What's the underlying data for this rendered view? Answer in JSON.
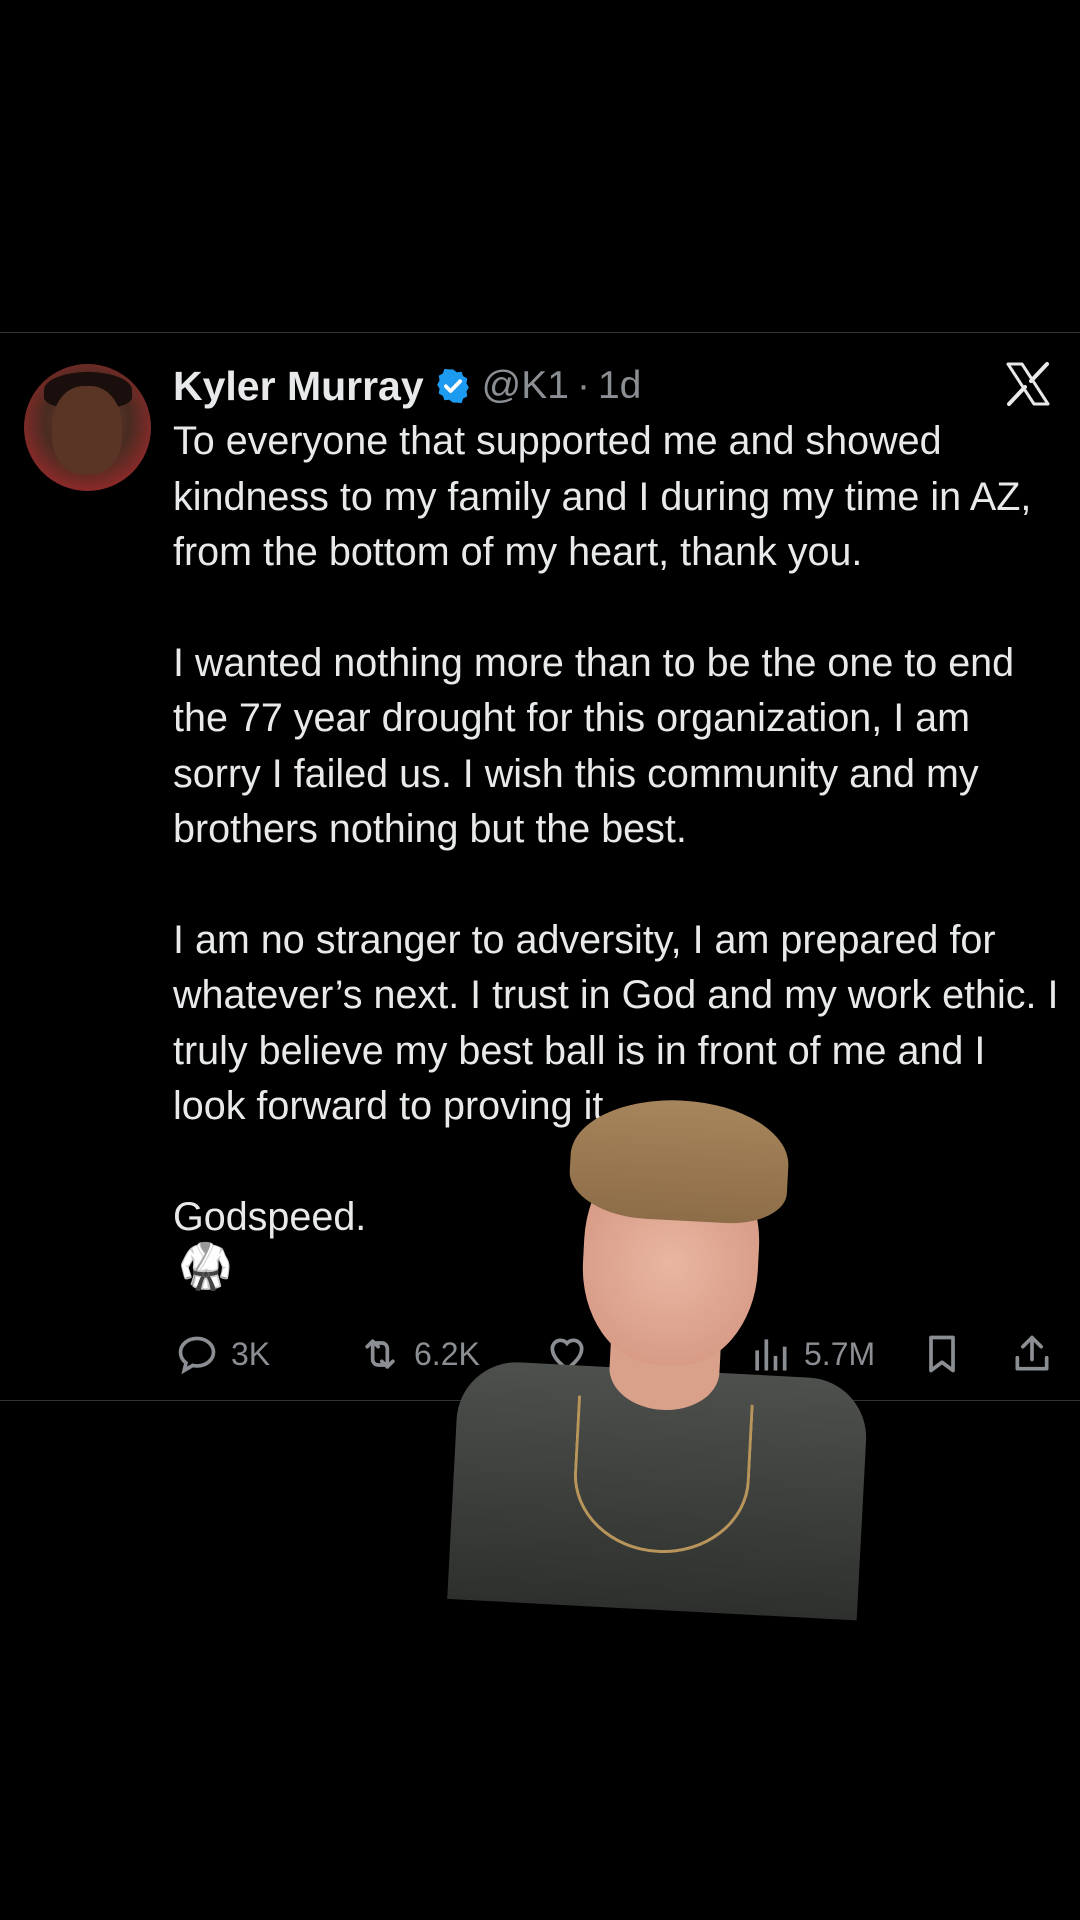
{
  "author": {
    "name": "Kyler Murray",
    "handle": "@K1",
    "separator": "·",
    "time": "1d",
    "verified": true
  },
  "tweet": {
    "paragraphs": [
      "To everyone that supported me and showed kindness to my family and I during my time in AZ, from the bottom of my heart, thank you.",
      "I wanted nothing more than to be the one to end the 77 year drought for this organization, I am sorry I failed us. I wish this community and my brothers nothing but the best.",
      "I am no stranger to adversity, I am prepared for whatever’s next. I trust in God and my work ethic. I truly believe my best ball is in front of me and I look forward to proving it.",
      "Godspeed."
    ],
    "emoji": "🥋"
  },
  "actions": {
    "replies": "3K",
    "reposts": "6.2K",
    "views": "5.7M"
  },
  "colors": {
    "background": "#000000",
    "text": "#e7e9ea",
    "muted": "#8b8f94",
    "verified": "#1d9bf0",
    "divider": "#2f3336"
  }
}
